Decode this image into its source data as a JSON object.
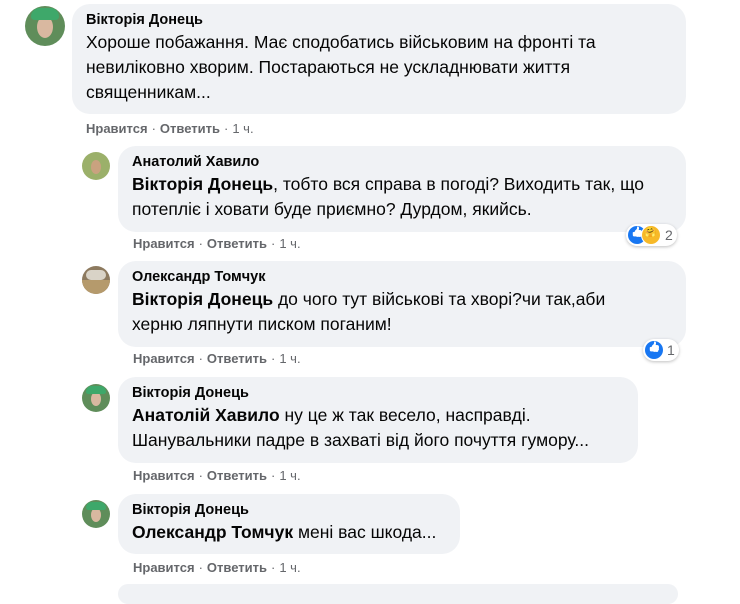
{
  "comments": [
    {
      "author": "Вікторія Донець",
      "mention": "",
      "lines": [
        "Хороше побажання. Має сподобатись військовим на фронті та",
        "невиліковно хворим. Постараються не ускладнювати життя",
        "священникам..."
      ],
      "like_label": "Нравится",
      "reply_label": "Ответить",
      "time": "1 ч."
    },
    {
      "author": "Анатолий Хавило",
      "mention": "Вікторія Донець",
      "lines": [
        ", тобто вся справа в погоді? Виходить так, що",
        "потепліє і ховати буде приємно? Дурдом, якийсь."
      ],
      "like_label": "Нравится",
      "reply_label": "Ответить",
      "time": "1 ч.",
      "reaction_count": "2"
    },
    {
      "author": "Олександр Томчук",
      "mention": "Вікторія Донець",
      "lines": [
        " до чого тут військові та хворі?чи так,аби",
        "херню ляпнути писком поганим!"
      ],
      "like_label": "Нравится",
      "reply_label": "Ответить",
      "time": "1 ч.",
      "reaction_count": "1"
    },
    {
      "author": "Вікторія Донець",
      "mention": "Анатолій Хавило",
      "lines": [
        " ну це ж так весело, насправді.",
        "Шанувальники падре в захваті від його почуття гумору..."
      ],
      "like_label": "Нравится",
      "reply_label": "Ответить",
      "time": "1 ч."
    },
    {
      "author": "Вікторія Донець",
      "mention": "Олександр Томчук",
      "lines": [
        " мені вас шкода..."
      ],
      "like_label": "Нравится",
      "reply_label": "Ответить",
      "time": "1 ч."
    }
  ],
  "icons": {
    "like": "like-reaction-icon",
    "care": "care-reaction-icon"
  },
  "colors": {
    "bubble": "#f0f2f5",
    "meta": "#65676b",
    "like_blue": "#1877f2",
    "care_yellow": "#f7b928"
  }
}
